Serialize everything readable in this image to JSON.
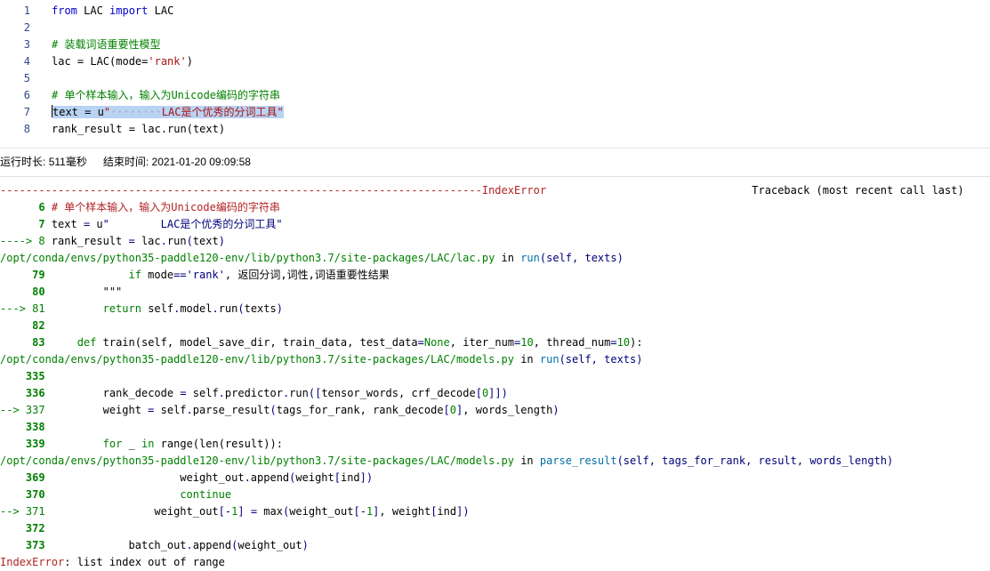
{
  "editor": {
    "lines": [
      {
        "num": "1",
        "parts": [
          {
            "t": "from",
            "c": "kw"
          },
          {
            "t": " LAC ",
            "c": ""
          },
          {
            "t": "import",
            "c": "kw"
          },
          {
            "t": " LAC",
            "c": ""
          }
        ]
      },
      {
        "num": "2",
        "parts": []
      },
      {
        "num": "3",
        "parts": [
          {
            "t": "# 装载词语重要性模型",
            "c": "cm"
          }
        ]
      },
      {
        "num": "4",
        "parts": [
          {
            "t": "lac = LAC(mode=",
            "c": ""
          },
          {
            "t": "'rank'",
            "c": "st"
          },
          {
            "t": ")",
            "c": ""
          }
        ]
      },
      {
        "num": "5",
        "parts": []
      },
      {
        "num": "6",
        "parts": [
          {
            "t": "# 单个样本输入，输入为Unicode编码的字符串",
            "c": "cm"
          }
        ]
      },
      {
        "num": "7",
        "parts": [
          {
            "t": "text = u",
            "c": "sel"
          },
          {
            "t": "\"",
            "c": "sel st"
          },
          {
            "t": "········",
            "c": "sel ws"
          },
          {
            "t": "LAC是个优秀的分词工具\"",
            "c": "sel st"
          }
        ]
      },
      {
        "num": "8",
        "parts": [
          {
            "t": "rank_result = lac.run(text)",
            "c": ""
          }
        ]
      }
    ]
  },
  "runinfo": {
    "duration_label": "运行时长:",
    "duration_value": "511毫秒",
    "end_label": "结束时间:",
    "end_value": "2021-01-20 09:09:58"
  },
  "traceback": {
    "lines": [
      [
        {
          "t": "---------------------------------------------------------------------------",
          "c": "red"
        },
        {
          "t": "IndexError",
          "c": "red"
        },
        {
          "t": "                                Traceback (most recent call last)",
          "c": ""
        }
      ],
      [
        {
          "t": "      ",
          "c": ""
        },
        {
          "t": "6",
          "c": "green-b"
        },
        {
          "t": " # 单个样本输入，输入为Unicode编码的字符串",
          "c": "red"
        }
      ],
      [
        {
          "t": "      ",
          "c": ""
        },
        {
          "t": "7",
          "c": "green-b"
        },
        {
          "t": " text ",
          "c": ""
        },
        {
          "t": "=",
          "c": "blu"
        },
        {
          "t": " u",
          "c": ""
        },
        {
          "t": "\"        LAC是个优秀的分词工具\"",
          "c": "blu"
        }
      ],
      [
        {
          "t": "----> 8 ",
          "c": "grn"
        },
        {
          "t": "rank_result ",
          "c": ""
        },
        {
          "t": "=",
          "c": "blu"
        },
        {
          "t": " lac",
          "c": ""
        },
        {
          "t": ".",
          "c": "blu"
        },
        {
          "t": "run",
          "c": ""
        },
        {
          "t": "(",
          "c": "blu"
        },
        {
          "t": "text",
          "c": ""
        },
        {
          "t": ")",
          "c": "blu"
        }
      ],
      [
        {
          "t": "/opt/conda/envs/python35-paddle120-env/lib/python3.7/site-packages/LAC/lac.py",
          "c": "grn"
        },
        {
          "t": " in ",
          "c": ""
        },
        {
          "t": "run",
          "c": "fn"
        },
        {
          "t": "(self, texts)",
          "c": "blu"
        }
      ],
      [
        {
          "t": "     ",
          "c": ""
        },
        {
          "t": "79",
          "c": "green-b"
        },
        {
          "t": "             ",
          "c": ""
        },
        {
          "t": "if",
          "c": "grn"
        },
        {
          "t": " mode",
          "c": ""
        },
        {
          "t": "==",
          "c": "blu"
        },
        {
          "t": "'rank'",
          "c": "blu"
        },
        {
          "t": ", 返回分词,词性,词语重要性结果",
          "c": ""
        }
      ],
      [
        {
          "t": "     ",
          "c": ""
        },
        {
          "t": "80",
          "c": "green-b"
        },
        {
          "t": "         \"\"\"",
          "c": ""
        }
      ],
      [
        {
          "t": "---> 81",
          "c": "grn"
        },
        {
          "t": "         ",
          "c": ""
        },
        {
          "t": "return",
          "c": "grn"
        },
        {
          "t": " self",
          "c": ""
        },
        {
          "t": ".",
          "c": "blu"
        },
        {
          "t": "model",
          "c": ""
        },
        {
          "t": ".",
          "c": "blu"
        },
        {
          "t": "run",
          "c": ""
        },
        {
          "t": "(",
          "c": "blu"
        },
        {
          "t": "texts",
          "c": ""
        },
        {
          "t": ")",
          "c": "blu"
        }
      ],
      [
        {
          "t": "     ",
          "c": ""
        },
        {
          "t": "82",
          "c": "green-b"
        }
      ],
      [
        {
          "t": "     ",
          "c": ""
        },
        {
          "t": "83",
          "c": "green-b"
        },
        {
          "t": "     ",
          "c": ""
        },
        {
          "t": "def",
          "c": "grn"
        },
        {
          "t": " train(self, model_save_dir, train_data, test_data",
          "c": ""
        },
        {
          "t": "=",
          "c": "blu"
        },
        {
          "t": "None",
          "c": "grn"
        },
        {
          "t": ", iter_num",
          "c": ""
        },
        {
          "t": "=",
          "c": "blu"
        },
        {
          "t": "10",
          "c": "num"
        },
        {
          "t": ", thread_num",
          "c": ""
        },
        {
          "t": "=",
          "c": "blu"
        },
        {
          "t": "10",
          "c": "num"
        },
        {
          "t": "):",
          "c": ""
        }
      ],
      [
        {
          "t": "/opt/conda/envs/python35-paddle120-env/lib/python3.7/site-packages/LAC/models.py",
          "c": "grn"
        },
        {
          "t": " in ",
          "c": ""
        },
        {
          "t": "run",
          "c": "fn"
        },
        {
          "t": "(self, texts)",
          "c": "blu"
        }
      ],
      [
        {
          "t": "    ",
          "c": ""
        },
        {
          "t": "335",
          "c": "green-b"
        }
      ],
      [
        {
          "t": "    ",
          "c": ""
        },
        {
          "t": "336",
          "c": "green-b"
        },
        {
          "t": "         rank_decode ",
          "c": ""
        },
        {
          "t": "=",
          "c": "blu"
        },
        {
          "t": " self",
          "c": ""
        },
        {
          "t": ".",
          "c": "blu"
        },
        {
          "t": "predictor",
          "c": ""
        },
        {
          "t": ".",
          "c": "blu"
        },
        {
          "t": "run",
          "c": ""
        },
        {
          "t": "([",
          "c": "blu"
        },
        {
          "t": "tensor_words, crf_decode",
          "c": ""
        },
        {
          "t": "[",
          "c": "blu"
        },
        {
          "t": "0",
          "c": "num"
        },
        {
          "t": "]])",
          "c": "blu"
        }
      ],
      [
        {
          "t": "--> 337",
          "c": "grn"
        },
        {
          "t": "         weight ",
          "c": ""
        },
        {
          "t": "=",
          "c": "blu"
        },
        {
          "t": " self",
          "c": ""
        },
        {
          "t": ".",
          "c": "blu"
        },
        {
          "t": "parse_result",
          "c": ""
        },
        {
          "t": "(",
          "c": "blu"
        },
        {
          "t": "tags_for_rank, rank_decode",
          "c": ""
        },
        {
          "t": "[",
          "c": "blu"
        },
        {
          "t": "0",
          "c": "num"
        },
        {
          "t": "]",
          "c": "blu"
        },
        {
          "t": ", words_length",
          "c": ""
        },
        {
          "t": ")",
          "c": "blu"
        }
      ],
      [
        {
          "t": "    ",
          "c": ""
        },
        {
          "t": "338",
          "c": "green-b"
        }
      ],
      [
        {
          "t": "    ",
          "c": ""
        },
        {
          "t": "339",
          "c": "green-b"
        },
        {
          "t": "         ",
          "c": ""
        },
        {
          "t": "for",
          "c": "grn"
        },
        {
          "t": " _ ",
          "c": ""
        },
        {
          "t": "in",
          "c": "grn"
        },
        {
          "t": " range(len(result)):",
          "c": ""
        }
      ],
      [
        {
          "t": "/opt/conda/envs/python35-paddle120-env/lib/python3.7/site-packages/LAC/models.py",
          "c": "grn"
        },
        {
          "t": " in ",
          "c": ""
        },
        {
          "t": "parse_result",
          "c": "fn"
        },
        {
          "t": "(self, tags_for_rank, result, words_length)",
          "c": "blu"
        }
      ],
      [
        {
          "t": "    ",
          "c": ""
        },
        {
          "t": "369",
          "c": "green-b"
        },
        {
          "t": "                     weight_out",
          "c": ""
        },
        {
          "t": ".",
          "c": "blu"
        },
        {
          "t": "append",
          "c": ""
        },
        {
          "t": "(",
          "c": "blu"
        },
        {
          "t": "weight",
          "c": ""
        },
        {
          "t": "[",
          "c": "blu"
        },
        {
          "t": "ind",
          "c": ""
        },
        {
          "t": "])",
          "c": "blu"
        }
      ],
      [
        {
          "t": "    ",
          "c": ""
        },
        {
          "t": "370",
          "c": "green-b"
        },
        {
          "t": "                     ",
          "c": ""
        },
        {
          "t": "continue",
          "c": "grn"
        }
      ],
      [
        {
          "t": "--> 371",
          "c": "grn"
        },
        {
          "t": "                 weight_out",
          "c": ""
        },
        {
          "t": "[",
          "c": "blu"
        },
        {
          "t": "-",
          "c": "blu"
        },
        {
          "t": "1",
          "c": "num"
        },
        {
          "t": "]",
          "c": "blu"
        },
        {
          "t": " ",
          "c": ""
        },
        {
          "t": "=",
          "c": "blu"
        },
        {
          "t": " max",
          "c": ""
        },
        {
          "t": "(",
          "c": "blu"
        },
        {
          "t": "weight_out",
          "c": ""
        },
        {
          "t": "[",
          "c": "blu"
        },
        {
          "t": "-",
          "c": "blu"
        },
        {
          "t": "1",
          "c": "num"
        },
        {
          "t": "]",
          "c": "blu"
        },
        {
          "t": ", weight",
          "c": ""
        },
        {
          "t": "[",
          "c": "blu"
        },
        {
          "t": "ind",
          "c": ""
        },
        {
          "t": "])",
          "c": "blu"
        }
      ],
      [
        {
          "t": "    ",
          "c": ""
        },
        {
          "t": "372",
          "c": "green-b"
        }
      ],
      [
        {
          "t": "    ",
          "c": ""
        },
        {
          "t": "373",
          "c": "green-b"
        },
        {
          "t": "             batch_out",
          "c": ""
        },
        {
          "t": ".",
          "c": "blu"
        },
        {
          "t": "append",
          "c": ""
        },
        {
          "t": "(",
          "c": "blu"
        },
        {
          "t": "weight_out",
          "c": ""
        },
        {
          "t": ")",
          "c": "blu"
        }
      ],
      [
        {
          "t": "IndexError",
          "c": "red"
        },
        {
          "t": ": list index out of range",
          "c": ""
        }
      ]
    ]
  }
}
